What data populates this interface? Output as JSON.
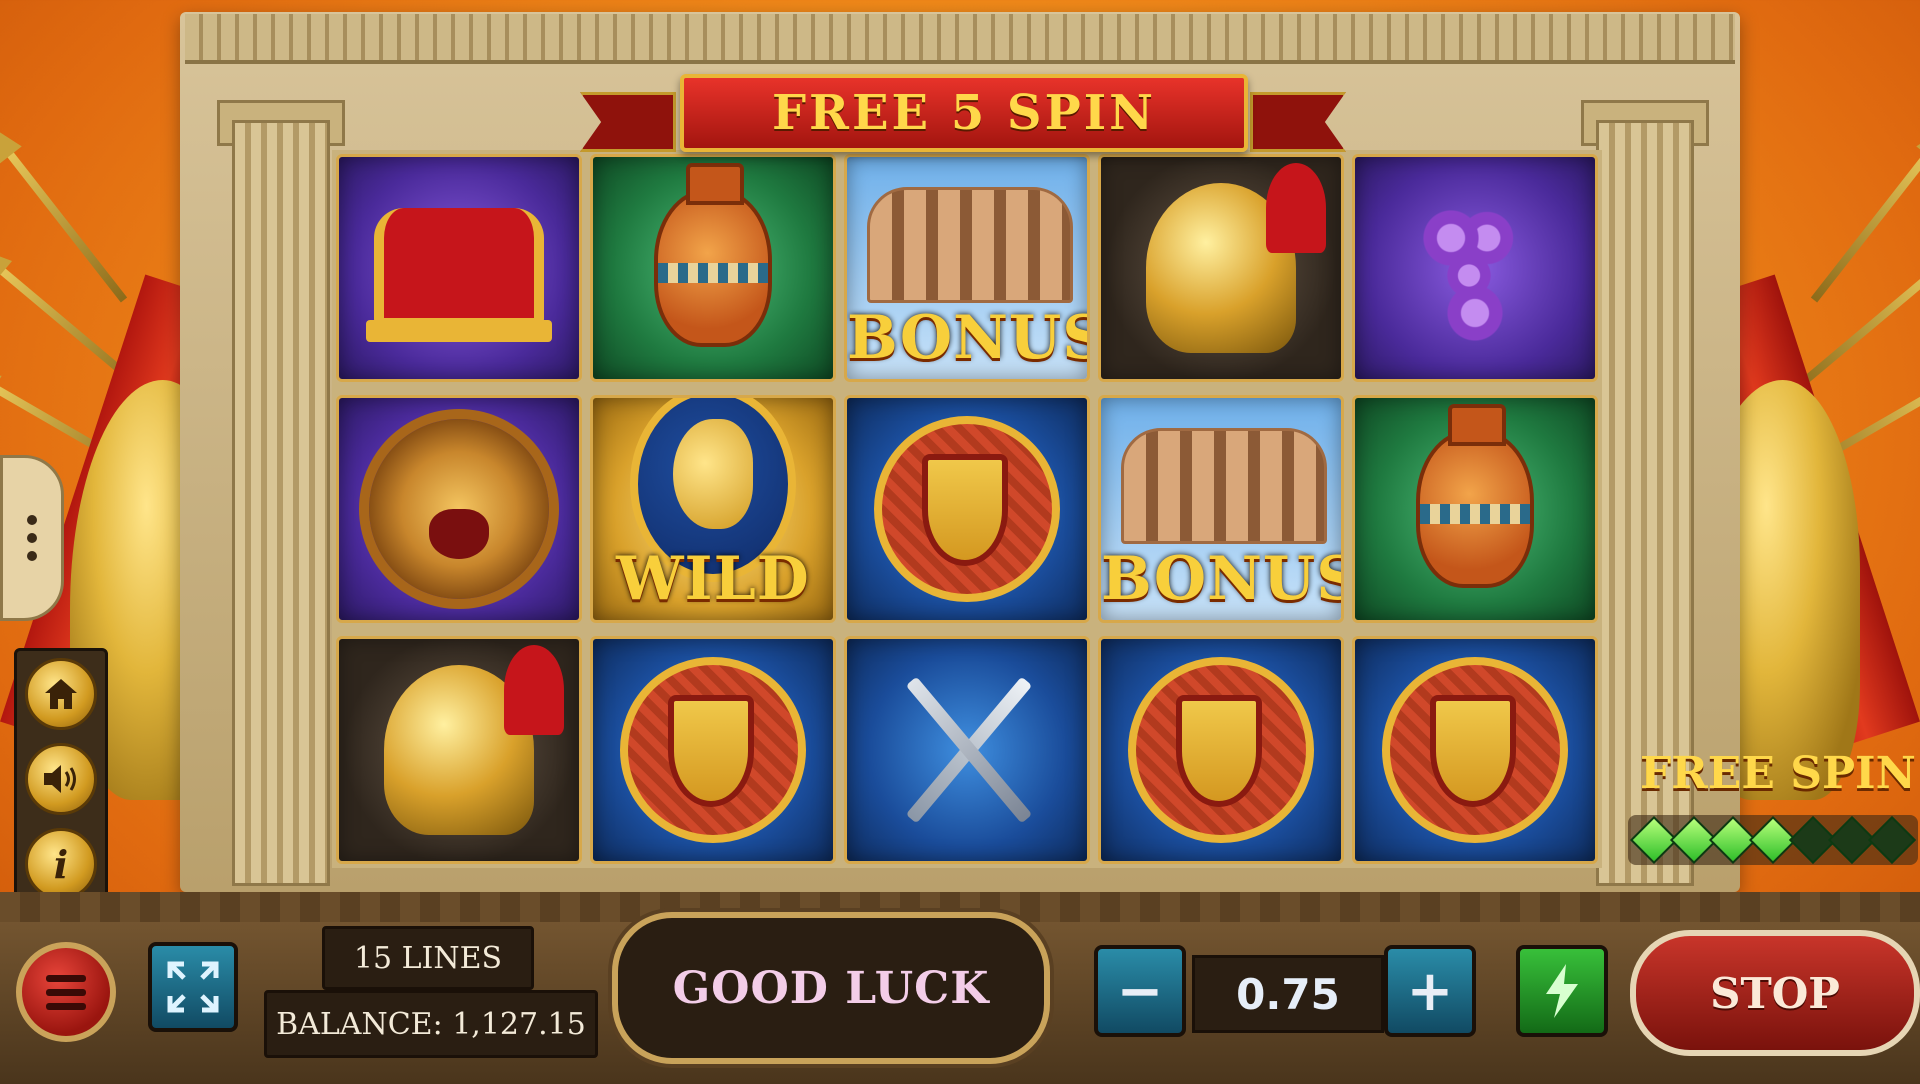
{
  "ribbon": {
    "title": "FREE 5 SPIN"
  },
  "reels": [
    [
      {
        "symbol": "crown",
        "bg": "purple",
        "label": ""
      },
      {
        "symbol": "amphora-vase",
        "bg": "green",
        "label": ""
      },
      {
        "symbol": "colosseum",
        "bg": "sky",
        "label": "BONUS"
      },
      {
        "symbol": "gladiator-helmet",
        "bg": "dark",
        "label": ""
      },
      {
        "symbol": "grapes",
        "bg": "purple",
        "label": ""
      }
    ],
    [
      {
        "symbol": "lion",
        "bg": "purple",
        "label": ""
      },
      {
        "symbol": "emperor-bust",
        "bg": "gold",
        "label": "WILD"
      },
      {
        "symbol": "shield",
        "bg": "blue",
        "label": ""
      },
      {
        "symbol": "colosseum",
        "bg": "sky",
        "label": "BONUS"
      },
      {
        "symbol": "amphora-vase",
        "bg": "green",
        "label": ""
      }
    ],
    [
      {
        "symbol": "gladiator-helmet",
        "bg": "dark",
        "label": ""
      },
      {
        "symbol": "shield",
        "bg": "blue",
        "label": ""
      },
      {
        "symbol": "crossed-swords",
        "bg": "blue",
        "label": ""
      },
      {
        "symbol": "shield",
        "bg": "blue",
        "label": ""
      },
      {
        "symbol": "shield",
        "bg": "blue",
        "label": ""
      }
    ]
  ],
  "side_menu": {
    "home_icon": "home-icon",
    "sound_icon": "speaker-icon",
    "info_icon": "info-icon",
    "info_glyph": "i"
  },
  "free_spin": {
    "label": "FREE SPIN",
    "gems_lit": 4,
    "gems_total": 7
  },
  "bottom": {
    "lines": "15 LINES",
    "balance": "BALANCE: 1,127.15",
    "message": "GOOD LUCK",
    "bet_value": "0.75",
    "minus": "−",
    "plus": "+",
    "stop": "STOP"
  },
  "colors": {
    "gold": "#e9b536",
    "ribbon_red": "#c6151b",
    "accent_green": "#2fbf2a"
  }
}
